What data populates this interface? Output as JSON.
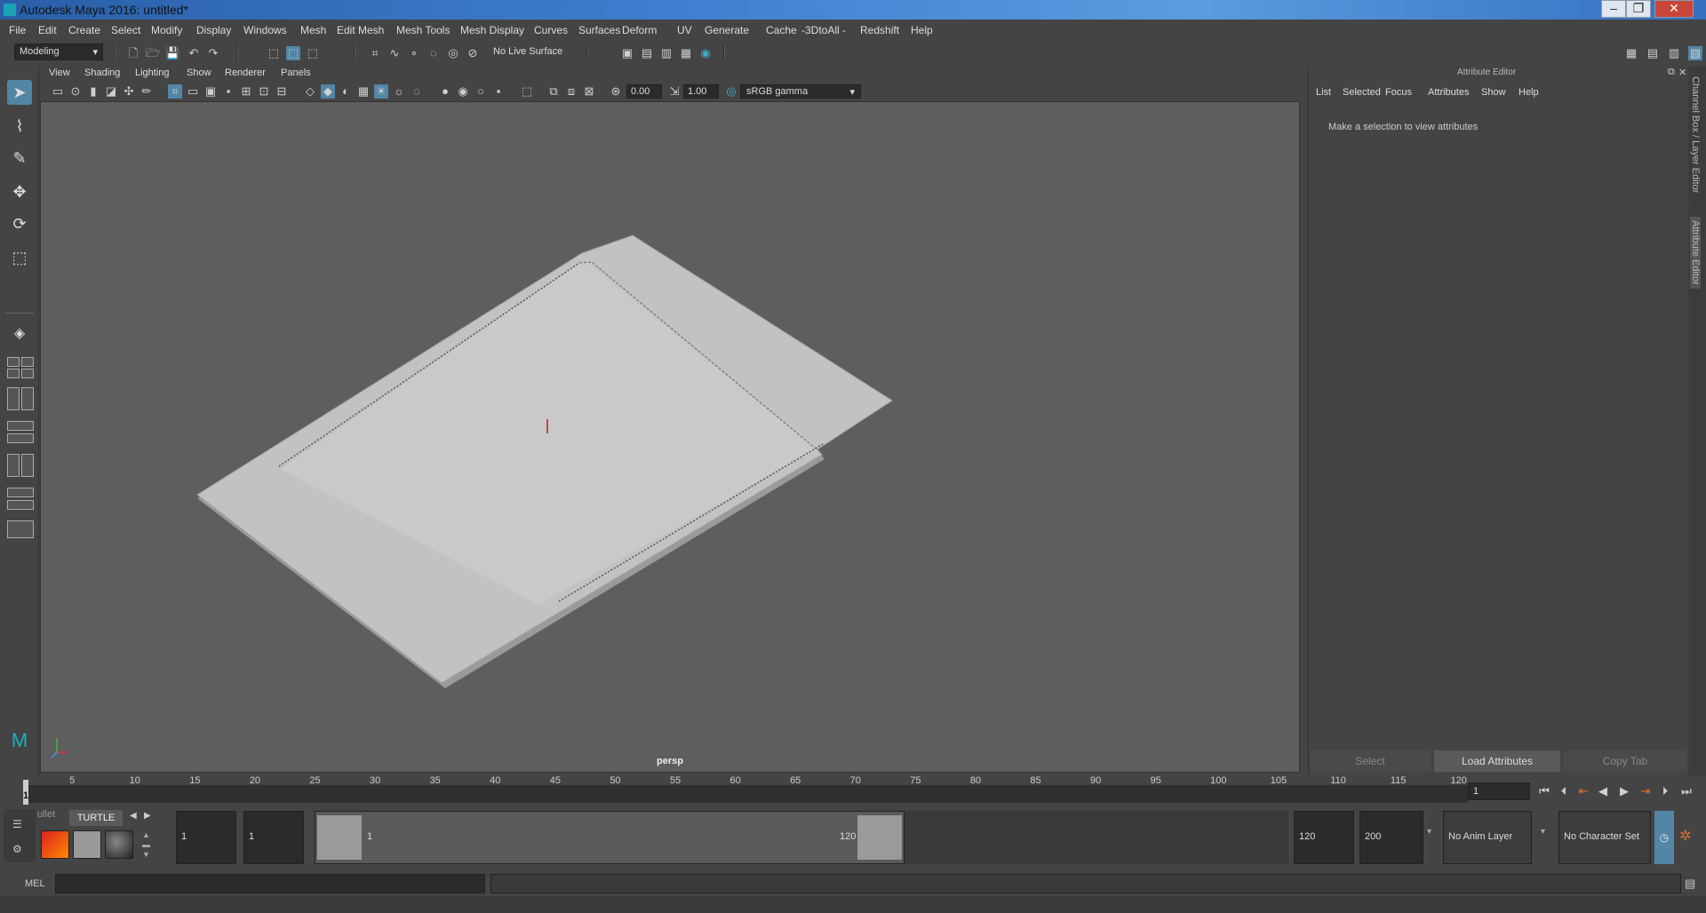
{
  "window": {
    "title": "Autodesk Maya 2016: untitled*"
  },
  "menubar": {
    "items": [
      "File",
      "Edit",
      "Create",
      "Select",
      "Modify",
      "Display",
      "Windows",
      "Mesh",
      "Edit Mesh",
      "Mesh Tools",
      "Mesh Display",
      "Curves",
      "Surfaces",
      "Deform",
      "UV",
      "Generate",
      "Cache",
      "-3DtoAll -",
      "Redshift",
      "Help"
    ]
  },
  "shelf": {
    "mode": "Modeling",
    "live_surface": "No Live Surface"
  },
  "viewport": {
    "menu": [
      "View",
      "Shading",
      "Lighting",
      "Show",
      "Renderer",
      "Panels"
    ],
    "exposure": "0.00",
    "gamma": "1.00",
    "colorspace": "sRGB gamma",
    "camera": "persp"
  },
  "attribute_editor": {
    "title": "Attribute Editor",
    "menu": [
      "List",
      "Selected",
      "Focus",
      "Attributes",
      "Show",
      "Help"
    ],
    "message": "Make a selection to view attributes",
    "buttons": {
      "select": "Select",
      "load": "Load Attributes",
      "copy": "Copy Tab"
    }
  },
  "side_tabs": [
    "Channel Box / Layer Editor",
    "Attribute Editor"
  ],
  "timeline": {
    "ticks": [
      "5",
      "10",
      "15",
      "20",
      "25",
      "30",
      "35",
      "40",
      "45",
      "50",
      "55",
      "60",
      "65",
      "70",
      "75",
      "80",
      "85",
      "90",
      "95",
      "100",
      "105",
      "110",
      "115",
      "120"
    ],
    "start_marker": "1",
    "current_frame": "1"
  },
  "range": {
    "shelf_tabs": [
      "ullet",
      "TURTLE"
    ],
    "start": "1",
    "playback_start": "1",
    "slider_start": "1",
    "slider_end": "120",
    "playback_end": "120",
    "end": "200",
    "anim_layer": "No Anim Layer",
    "character_set": "No Character Set"
  },
  "mel": {
    "label": "MEL"
  }
}
